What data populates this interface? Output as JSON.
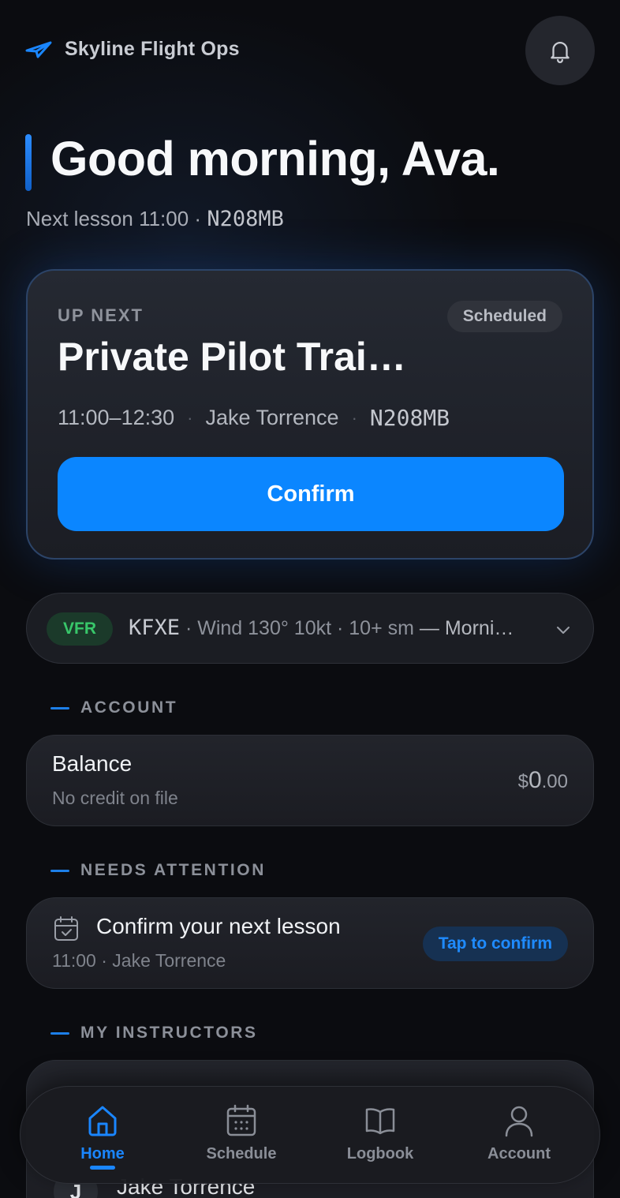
{
  "app": {
    "name": "Skyline Flight Ops"
  },
  "greeting": {
    "title": "Good morning, Ava.",
    "next_prefix": "Next lesson 11:00 · ",
    "tail_number": "N208MB"
  },
  "up_next": {
    "eyebrow": "UP NEXT",
    "status": "Scheduled",
    "title": "Private Pilot Trai…",
    "time": "11:00–12:30",
    "separator": "·",
    "instructor": "Jake Torrence",
    "aircraft": "N208MB",
    "confirm_label": "Confirm"
  },
  "weather": {
    "category": "VFR",
    "station": "KFXE",
    "details": " · Wind 130° 10kt · 10+ sm",
    "description": " — Morni…"
  },
  "sections": {
    "account": "ACCOUNT",
    "needs_attention": "NEEDS ATTENTION",
    "instructors": "MY INSTRUCTORS"
  },
  "balance": {
    "title": "Balance",
    "subtitle": "No credit on file",
    "currency": "$",
    "whole": "0",
    "cents": ".00"
  },
  "attention": {
    "title": "Confirm your next lesson",
    "subtitle": "11:00 · Jake Torrence",
    "action": "Tap to confirm"
  },
  "instructors": [
    {
      "initial": "J",
      "name": "Jake Torrence"
    }
  ],
  "nav": {
    "items": [
      {
        "label": "Home",
        "icon": "home-icon",
        "active": true
      },
      {
        "label": "Schedule",
        "icon": "calendar-icon",
        "active": false
      },
      {
        "label": "Logbook",
        "icon": "book-icon",
        "active": false
      },
      {
        "label": "Account",
        "icon": "user-icon",
        "active": false
      }
    ]
  },
  "colors": {
    "accent": "#0b86ff",
    "vfr_green": "#38c76a",
    "background": "#0b0c10"
  }
}
